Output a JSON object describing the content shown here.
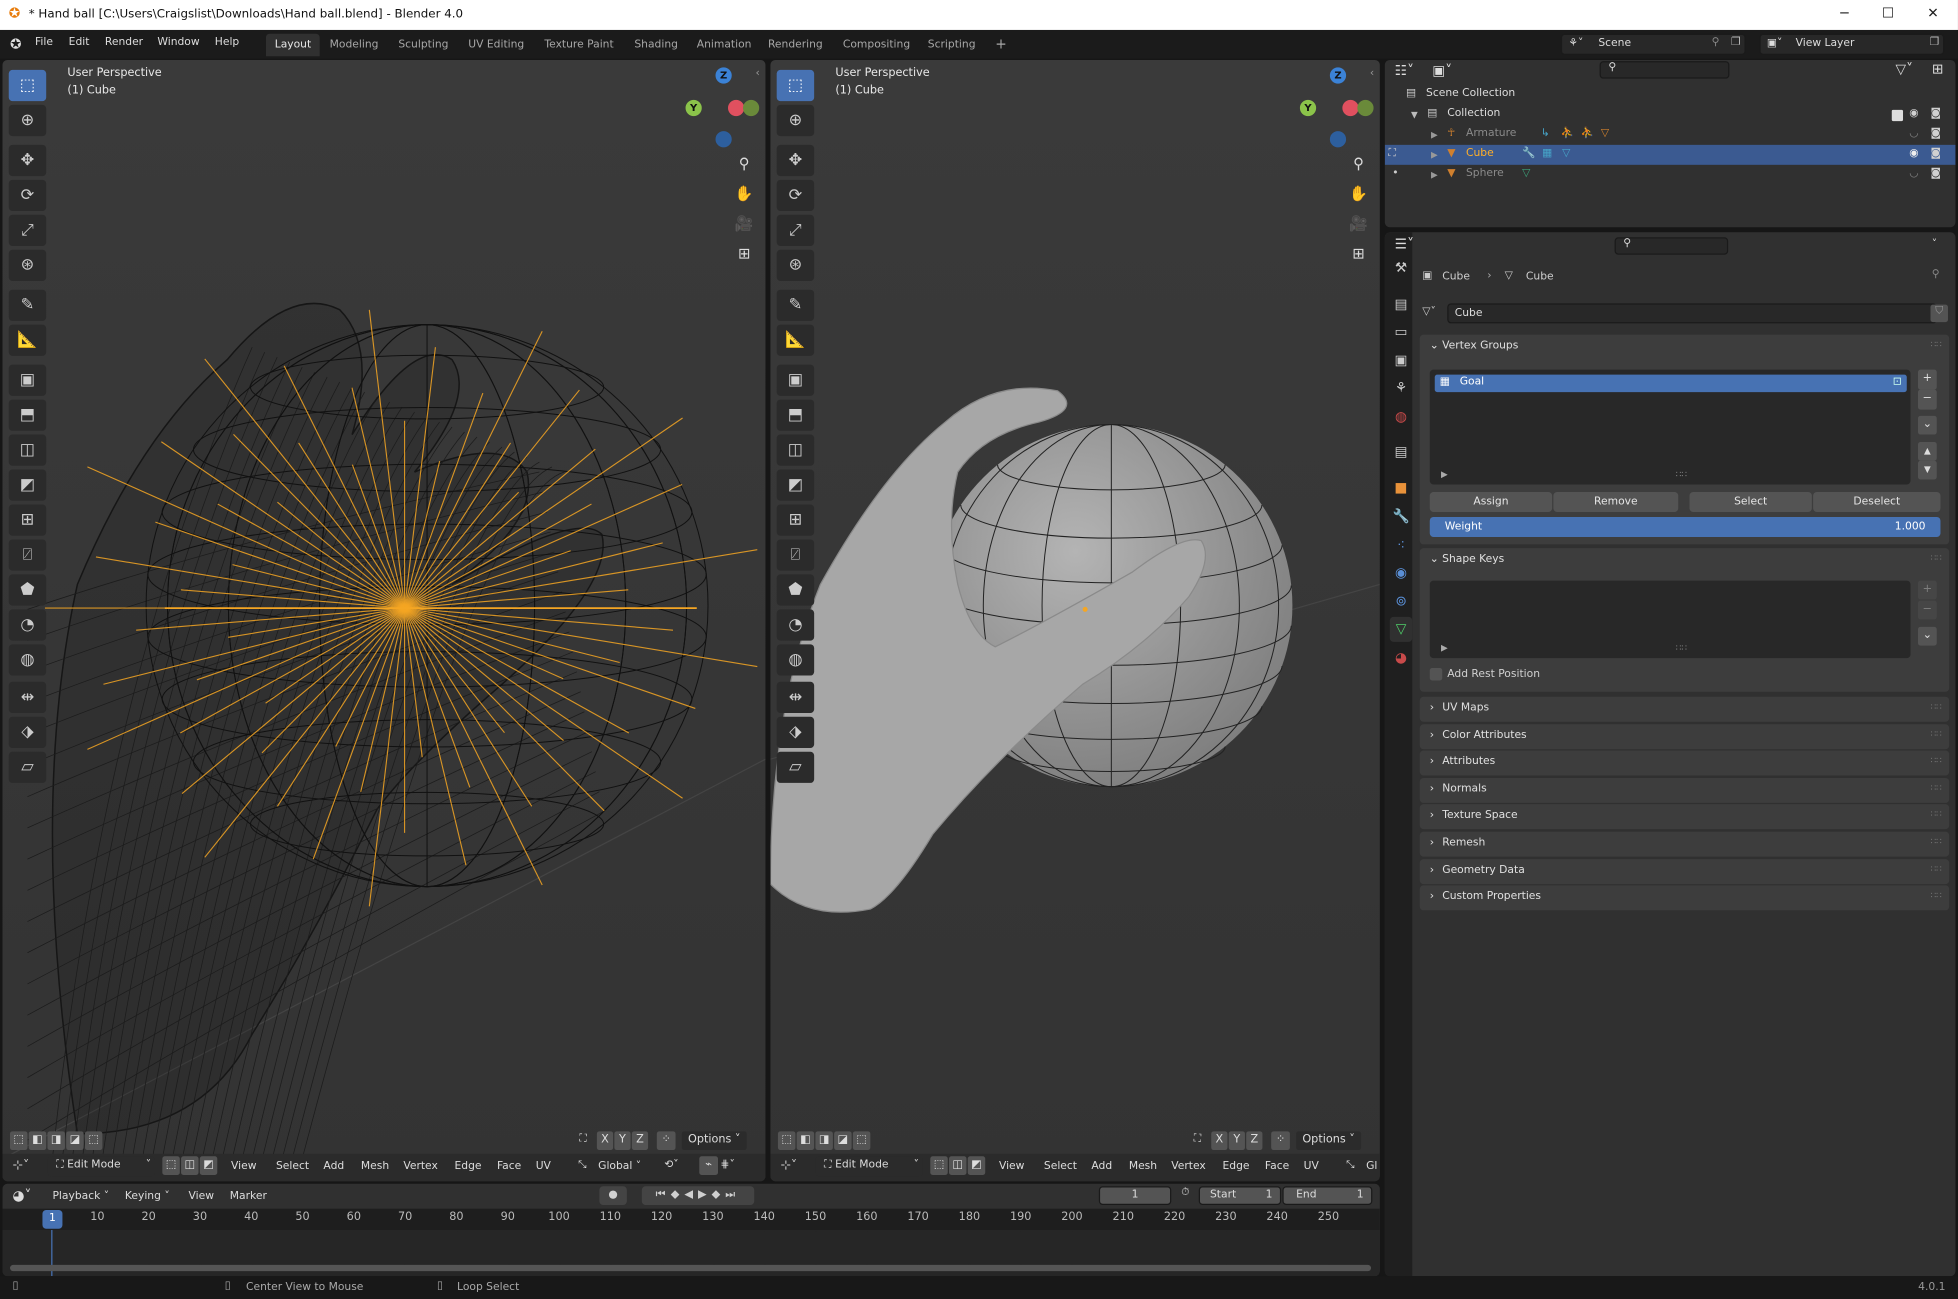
{
  "window": {
    "title": "* Hand ball [C:\\Users\\Craigslist\\Downloads\\Hand ball.blend] - Blender 4.0",
    "minimize": "─",
    "maximize": "☐",
    "close": "✕"
  },
  "menu": [
    "File",
    "Edit",
    "Render",
    "Window",
    "Help"
  ],
  "workspaces": {
    "tabs": [
      "Layout",
      "Modeling",
      "Sculpting",
      "UV Editing",
      "Texture Paint",
      "Shading",
      "Animation",
      "Rendering",
      "Compositing",
      "Scripting"
    ],
    "active": "Layout",
    "add": "+"
  },
  "scene": {
    "name": "Scene",
    "view_layer": "View Layer"
  },
  "viewports": [
    {
      "perspective": "User Perspective",
      "object": "(1) Cube",
      "mode": "Edit Mode",
      "menus": [
        "View",
        "Select",
        "Add",
        "Mesh",
        "Vertex",
        "Edge",
        "Face",
        "UV"
      ],
      "orientation": "Global",
      "axes": [
        "X",
        "Y",
        "Z"
      ],
      "options": "Options",
      "shading": "wireframe"
    },
    {
      "perspective": "User Perspective",
      "object": "(1) Cube",
      "mode": "Edit Mode",
      "menus": [
        "View",
        "Select",
        "Add",
        "Mesh",
        "Vertex",
        "Edge",
        "Face",
        "UV"
      ],
      "orientation": "Gl",
      "axes": [
        "X",
        "Y",
        "Z"
      ],
      "options": "Options",
      "shading": "solid"
    }
  ],
  "gizmo": {
    "z": "Z",
    "y": "Y",
    "x": "X"
  },
  "tools": [
    "select-box",
    "cursor",
    "move",
    "rotate",
    "scale",
    "transform",
    "annotate",
    "measure",
    "add-cube",
    "extrude-region",
    "inset-faces",
    "bevel",
    "loop-cut",
    "knife",
    "poly-build",
    "spin",
    "smooth",
    "edge-slide",
    "shrink-fatten",
    "shear"
  ],
  "outliner": {
    "root": "Scene Collection",
    "collection": "Collection",
    "items": [
      {
        "name": "Armature",
        "selected": false,
        "visible": false
      },
      {
        "name": "Cube",
        "selected": true,
        "visible": true
      },
      {
        "name": "Sphere",
        "selected": false,
        "visible": false
      }
    ]
  },
  "properties": {
    "breadcrumb": [
      "Cube",
      "Cube"
    ],
    "mesh_name": "Cube",
    "vertex_groups": {
      "title": "Vertex Groups",
      "items": [
        "Goal"
      ],
      "buttons": [
        "Assign",
        "Remove",
        "Select",
        "Deselect"
      ],
      "weight_label": "Weight",
      "weight_value": "1.000"
    },
    "shape_keys": {
      "title": "Shape Keys",
      "add_rest_position": "Add Rest Position",
      "add_rest_checked": false
    },
    "collapsed_panels": [
      "UV Maps",
      "Color Attributes",
      "Attributes",
      "Normals",
      "Texture Space",
      "Remesh",
      "Geometry Data",
      "Custom Properties"
    ],
    "tabs": [
      "tool",
      "render",
      "output",
      "view-layer",
      "scene",
      "world",
      "collection",
      "object",
      "modifiers",
      "particles",
      "physics",
      "constraints",
      "data",
      "material"
    ],
    "active_tab": "data"
  },
  "timeline": {
    "menus": [
      "Playback",
      "Keying",
      "View",
      "Marker"
    ],
    "current_frame": "1",
    "start_label": "Start",
    "start": "1",
    "end_label": "End",
    "end": "1",
    "ticks": [
      "10",
      "20",
      "30",
      "40",
      "50",
      "60",
      "70",
      "80",
      "90",
      "100",
      "110",
      "120",
      "130",
      "140",
      "150",
      "160",
      "170",
      "180",
      "190",
      "200",
      "210",
      "220",
      "230",
      "240",
      "250"
    ]
  },
  "status": {
    "hint1": "Center View to Mouse",
    "hint2": "Loop Select",
    "version": "4.0.1"
  },
  "colors": {
    "accent": "#4772b3",
    "selection_orange": "#f5a623",
    "axis_x": "#e0505f",
    "axis_y": "#8bc34a",
    "axis_z": "#3b82d6"
  }
}
